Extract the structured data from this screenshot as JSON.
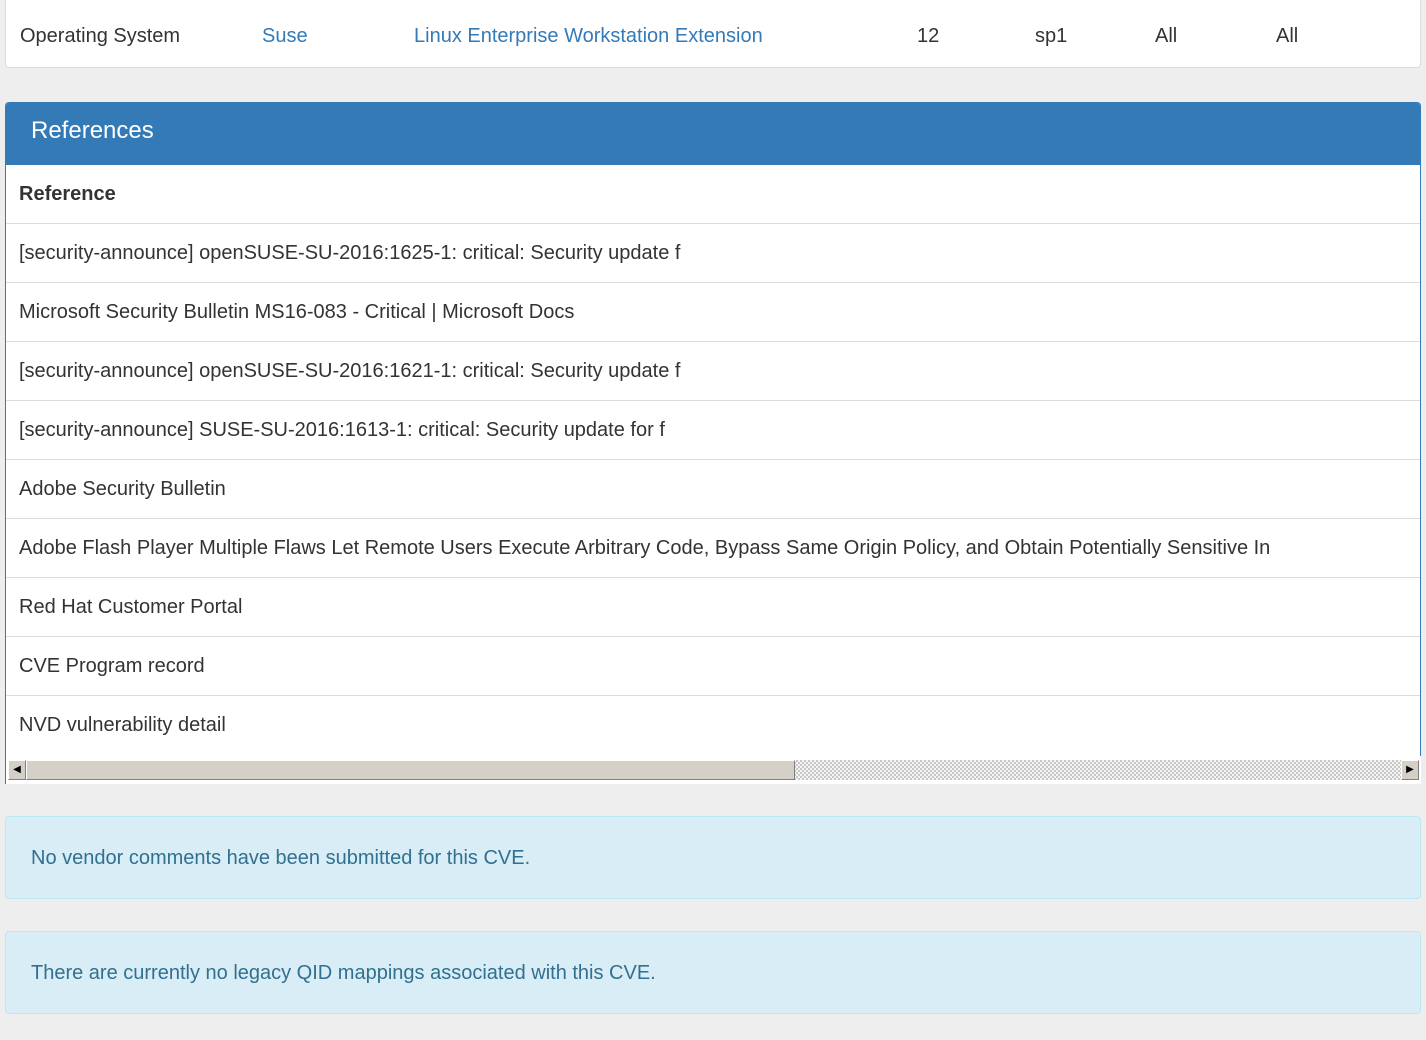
{
  "platform_row": {
    "type": "Operating System",
    "vendor": "Suse",
    "product": "Linux Enterprise Workstation Extension",
    "version": "12",
    "update": "sp1",
    "edition": "All",
    "language": "All"
  },
  "references": {
    "title": "References",
    "column_header": "Reference",
    "items": [
      "[security-announce] openSUSE-SU-2016:1625-1: critical: Security update f",
      "Microsoft Security Bulletin MS16-083 - Critical | Microsoft Docs",
      "[security-announce] openSUSE-SU-2016:1621-1: critical: Security update f",
      "[security-announce] SUSE-SU-2016:1613-1: critical: Security update for f",
      "Adobe Security Bulletin",
      "Adobe Flash Player Multiple Flaws Let Remote Users Execute Arbitrary Code, Bypass Same Origin Policy, and Obtain Potentially Sensitive In",
      "Red Hat Customer Portal",
      "CVE Program record",
      "NVD vulnerability detail"
    ]
  },
  "scrollbar": {
    "position_fraction": 0.559
  },
  "notices": {
    "vendor_comments": "No vendor comments have been submitted for this CVE.",
    "qid_mappings": "There are currently no legacy QID mappings associated with this CVE."
  },
  "colors": {
    "panel_header": "#337ab7",
    "link": "#337ab7",
    "info_background": "#d9edf7",
    "info_text": "#31708f"
  },
  "icons": {
    "scroll_left": "scroll-left-arrow-icon",
    "scroll_right": "scroll-right-arrow-icon"
  }
}
